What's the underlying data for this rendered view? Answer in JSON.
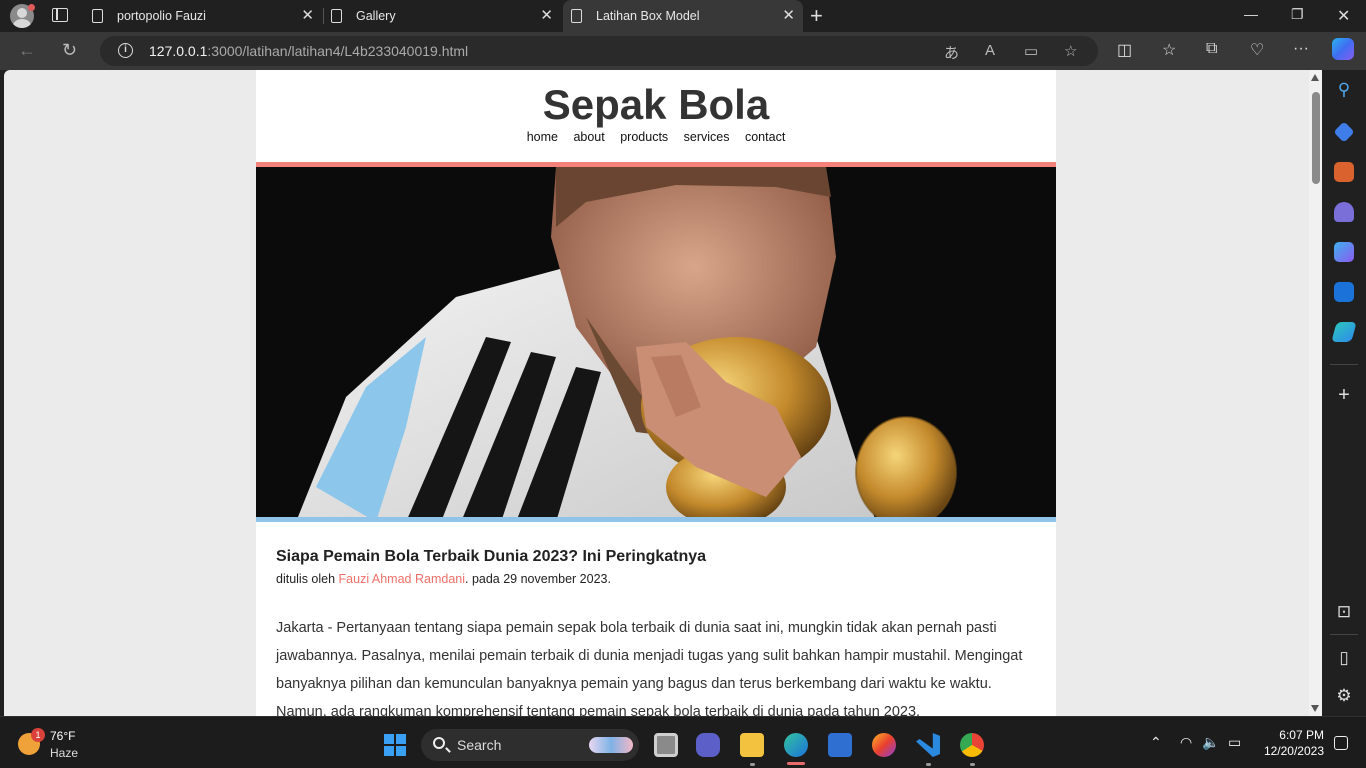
{
  "browser": {
    "tabs": [
      {
        "title": "portopolio Fauzi"
      },
      {
        "title": "Gallery"
      },
      {
        "title": "Latihan Box Model"
      }
    ],
    "active_tab_index": 2,
    "url_host": "127.0.0.1",
    "url_rest": ":3000/latihan/latihan4/L4b233040019.html",
    "icons": {
      "back": "back-arrow-icon",
      "reload": "reload-icon",
      "info": "info-icon"
    }
  },
  "page": {
    "site_title": "Sepak Bola",
    "nav": [
      "home",
      "about",
      "products",
      "services",
      "contact"
    ],
    "article": {
      "title": "Siapa Pemain Bola Terbaik Dunia 2023? Ini Peringkatnya",
      "byline_prefix": "ditulis oleh ",
      "author": "Fauzi Ahmad Ramdani",
      "byline_suffix": ". pada 29 november 2023.",
      "body": "Jakarta - Pertanyaan tentang siapa pemain sepak bola terbaik di dunia saat ini, mungkin tidak akan pernah pasti jawabannya. Pasalnya, menilai pemain terbaik di dunia menjadi tugas yang sulit bahkan hampir mustahil. Mengingat banyaknya pilihan dan kemunculan banyaknya pemain yang bagus dan terus berkembang dari waktu ke waktu. Namun, ada rangkuman komprehensif tentang pemain sepak bola terbaik di dunia pada tahun 2023."
    },
    "colors": {
      "header_border": "#f4827a",
      "hero_border": "#8fc3ea",
      "author_link": "#f07068"
    }
  },
  "taskbar": {
    "weather_temp": "76°F",
    "weather_desc": "Haze",
    "weather_badge": "1",
    "search_label": "Search",
    "time": "6:07 PM",
    "date": "12/20/2023"
  }
}
